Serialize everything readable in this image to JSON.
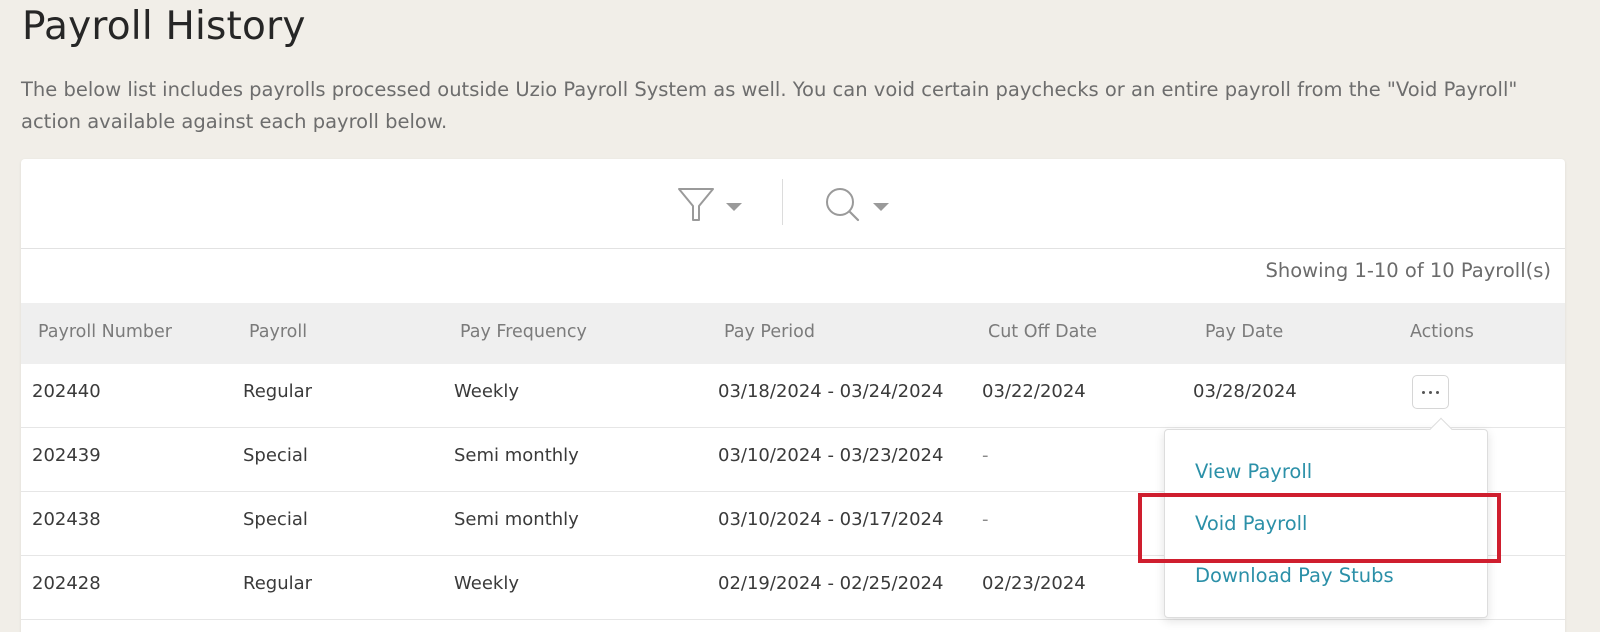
{
  "page": {
    "title": "Payroll History",
    "description": "The below list includes payrolls processed outside Uzio Payroll System as well. You can void certain paychecks or an entire payroll from the \"Void Payroll\" action available against each payroll below."
  },
  "toolbar": {
    "filter_icon": "filter-icon",
    "search_icon": "search-icon"
  },
  "results": {
    "showing": "Showing 1-10 of 10 Payroll(s)"
  },
  "table": {
    "headers": [
      "Payroll Number",
      "Payroll",
      "Pay Frequency",
      "Pay Period",
      "Cut Off Date",
      "Pay Date",
      "Actions"
    ],
    "rows": [
      {
        "number": "202440",
        "payroll": "Regular",
        "frequency": "Weekly",
        "period": "03/18/2024 - 03/24/2024",
        "cutoff": "03/22/2024",
        "paydate": "03/28/2024"
      },
      {
        "number": "202439",
        "payroll": "Special",
        "frequency": "Semi monthly",
        "period": "03/10/2024 - 03/23/2024",
        "cutoff": "-",
        "paydate": ""
      },
      {
        "number": "202438",
        "payroll": "Special",
        "frequency": "Semi monthly",
        "period": "03/10/2024 - 03/17/2024",
        "cutoff": "-",
        "paydate": ""
      },
      {
        "number": "202428",
        "payroll": "Regular",
        "frequency": "Weekly",
        "period": "02/19/2024 - 02/25/2024",
        "cutoff": "02/23/2024",
        "paydate": ""
      }
    ]
  },
  "actions_menu": {
    "items": [
      "View Payroll",
      "Void Payroll",
      "Download Pay Stubs"
    ]
  },
  "colors": {
    "background": "#f1eee8",
    "link": "#2b90a8",
    "highlight": "#cf1e2e",
    "header_bg": "#efefef"
  }
}
